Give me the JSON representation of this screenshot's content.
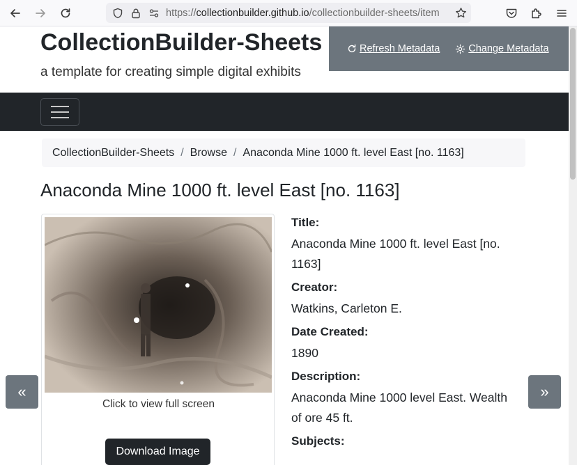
{
  "browser": {
    "url_prefix": "https://",
    "url_host": "collectionbuilder.github.io",
    "url_path": "/collectionbuilder-sheets/item"
  },
  "site": {
    "title": "CollectionBuilder-Sheets",
    "tagline": "a template for creating simple digital exhibits",
    "refresh_label": "Refresh Metadata",
    "change_label": "Change Metadata"
  },
  "breadcrumb": {
    "items": [
      "CollectionBuilder-Sheets",
      "Browse",
      "Anaconda Mine 1000 ft. level East [no. 1163]"
    ],
    "separator": "/"
  },
  "item": {
    "heading": "Anaconda Mine 1000 ft. level East [no. 1163]",
    "caption": "Click to view full screen",
    "download_label": "Download Image",
    "fields": [
      {
        "label": "Title:",
        "value": "Anaconda Mine 1000 ft. level East [no. 1163]"
      },
      {
        "label": "Creator:",
        "value": "Watkins, Carleton E."
      },
      {
        "label": "Date Created:",
        "value": "1890"
      },
      {
        "label": "Description:",
        "value": "Anaconda Mine 1000 level East. Wealth of ore 45 ft."
      },
      {
        "label": "Subjects:",
        "value": ""
      }
    ]
  },
  "pager": {
    "prev": "«",
    "next": "»"
  }
}
